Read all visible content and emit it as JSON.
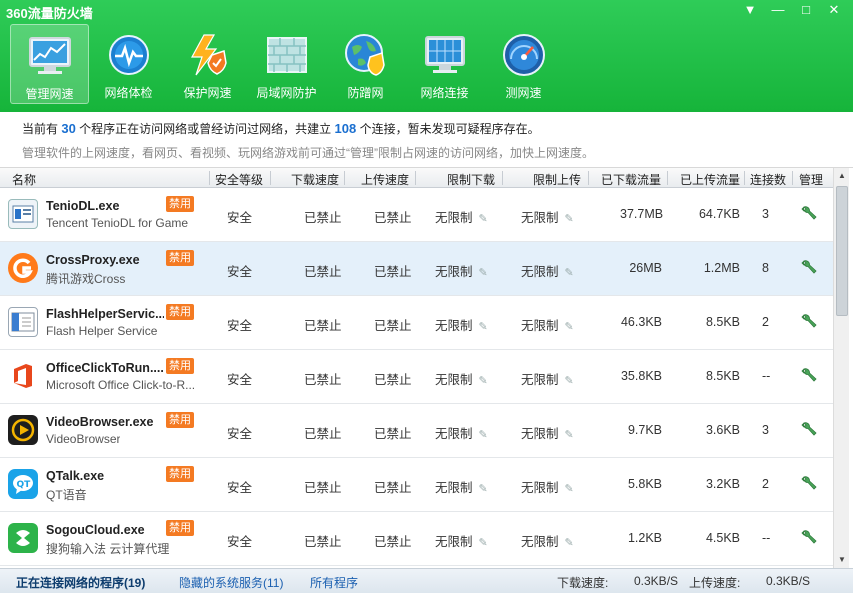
{
  "window": {
    "title": "360流量防火墙",
    "buttons": [
      "▼",
      "—",
      "□",
      "✕"
    ]
  },
  "toolbar": [
    {
      "label": "管理网速",
      "icon": "monitor-chart-icon",
      "active": true
    },
    {
      "label": "网络体检",
      "icon": "heartbeat-globe-icon",
      "active": false
    },
    {
      "label": "保护网速",
      "icon": "lightning-shield-icon",
      "active": false
    },
    {
      "label": "局域网防护",
      "icon": "brick-wall-icon",
      "active": false
    },
    {
      "label": "防蹭网",
      "icon": "globe-shield-icon",
      "active": false
    },
    {
      "label": "网络连接",
      "icon": "network-screen-icon",
      "active": false
    },
    {
      "label": "测网速",
      "icon": "speedometer-icon",
      "active": false
    }
  ],
  "info": {
    "prefix": "当前有",
    "programs": "30",
    "middle": "个程序正在访问网络或曾经访问过网络，共建立",
    "connections": "108",
    "suffix": "个连接，暂未发现可疑程序存在。",
    "tip": "管理软件的上网速度，看网页、看视频、玩网络游戏前可通过“管理”限制占网速的访问网络，加快上网速度。"
  },
  "columns": [
    "名称",
    "安全等级",
    "下载速度",
    "上传速度",
    "限制下载",
    "限制上传",
    "已下载流量",
    "已上传流量",
    "连接数",
    "管理"
  ],
  "ban_label": "禁用",
  "rows": [
    {
      "name": "TenioDL.exe",
      "desc": "Tencent TenioDL for Game",
      "icon": "teniodl-app-icon",
      "security": "安全",
      "down": "已禁止",
      "up": "已禁止",
      "limit_down": "无限制",
      "limit_up": "无限制",
      "downloaded": "37.7MB",
      "uploaded": "64.7KB",
      "conns": "3",
      "selected": false
    },
    {
      "name": "CrossProxy.exe",
      "desc": "腾讯游戏Cross",
      "icon": "crossproxy-app-icon",
      "security": "安全",
      "down": "已禁止",
      "up": "已禁止",
      "limit_down": "无限制",
      "limit_up": "无限制",
      "downloaded": "26MB",
      "uploaded": "1.2MB",
      "conns": "8",
      "selected": true
    },
    {
      "name": "FlashHelperServic...",
      "desc": "Flash Helper Service",
      "icon": "flashhelper-app-icon",
      "security": "安全",
      "down": "已禁止",
      "up": "已禁止",
      "limit_down": "无限制",
      "limit_up": "无限制",
      "downloaded": "46.3KB",
      "uploaded": "8.5KB",
      "conns": "2",
      "selected": false
    },
    {
      "name": "OfficeClickToRun....",
      "desc": "Microsoft Office Click-to-R...",
      "icon": "office-app-icon",
      "security": "安全",
      "down": "已禁止",
      "up": "已禁止",
      "limit_down": "无限制",
      "limit_up": "无限制",
      "downloaded": "35.8KB",
      "uploaded": "8.5KB",
      "conns": "--",
      "selected": false
    },
    {
      "name": "VideoBrowser.exe",
      "desc": "VideoBrowser",
      "icon": "videobrowser-app-icon",
      "security": "安全",
      "down": "已禁止",
      "up": "已禁止",
      "limit_down": "无限制",
      "limit_up": "无限制",
      "downloaded": "9.7KB",
      "uploaded": "3.6KB",
      "conns": "3",
      "selected": false
    },
    {
      "name": "QTalk.exe",
      "desc": "QT语音",
      "icon": "qtalk-app-icon",
      "security": "安全",
      "down": "已禁止",
      "up": "已禁止",
      "limit_down": "无限制",
      "limit_up": "无限制",
      "downloaded": "5.8KB",
      "uploaded": "3.2KB",
      "conns": "2",
      "selected": false
    },
    {
      "name": "SogouCloud.exe",
      "desc": "搜狗输入法 云计算代理",
      "icon": "sogoucloud-app-icon",
      "security": "安全",
      "down": "已禁止",
      "up": "已禁止",
      "limit_down": "无限制",
      "limit_up": "无限制",
      "downloaded": "1.2KB",
      "uploaded": "4.5KB",
      "conns": "--",
      "selected": false
    }
  ],
  "status": {
    "tab_active": "正在连接网络的程序(19)",
    "tab_hidden": "隐藏的系统服务(11)",
    "tab_all": "所有程序",
    "down_label": "下载速度:",
    "down_value": "0.3KB/S",
    "up_label": "上传速度:",
    "up_value": "0.3KB/S"
  },
  "colors": {
    "header": "#1fbe46",
    "link": "#1a6fd0",
    "ban": "#f47a22",
    "selected_row": "#e4f0fa"
  }
}
